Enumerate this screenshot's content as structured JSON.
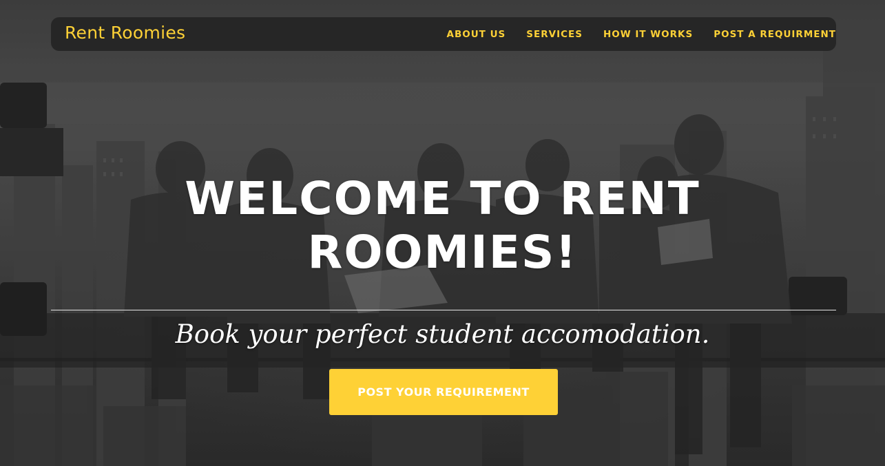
{
  "navbar": {
    "brand": "Rent Roomies",
    "links": [
      {
        "label": "ABOUT US"
      },
      {
        "label": "SERVICES"
      },
      {
        "label": "HOW IT WORKS"
      },
      {
        "label": "POST A REQUIRMENT"
      }
    ]
  },
  "hero": {
    "headline_line1": "WELCOME TO RENT",
    "headline_line2": "ROOMIES!",
    "subheading": "Book your perfect student accomodation.",
    "cta_label": "POST YOUR REQUIREMENT"
  },
  "colors": {
    "accent": "#fed136",
    "navbar_bg": "#222222",
    "text_light": "#ffffff"
  }
}
